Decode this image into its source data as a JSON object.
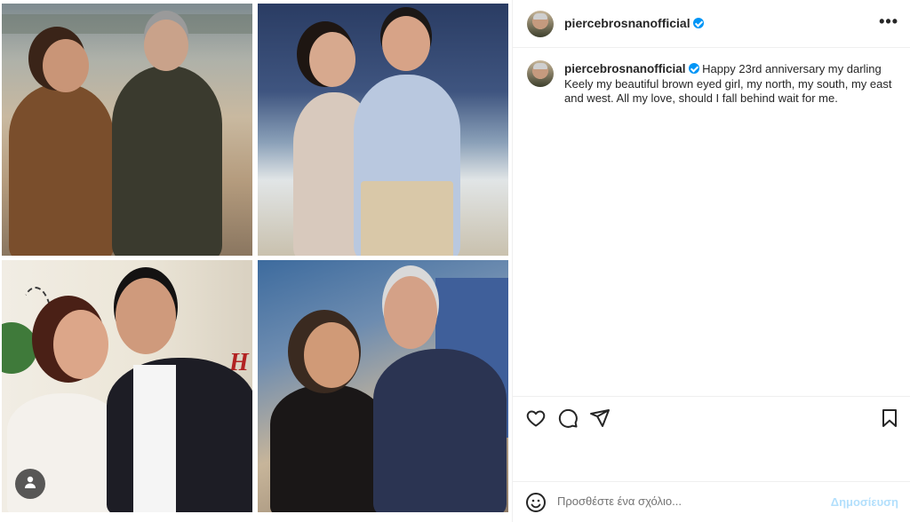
{
  "post": {
    "username": "piercebrosnanofficial",
    "caption_text": "Happy 23rd anniversary my darling Keely my beautiful brown eyed girl, my north, my south, my east and west. All my love, should I fall behind wait for me.",
    "photo3_sign": "H"
  },
  "header": {
    "more_label": "•••"
  },
  "actions": {
    "like_icon": "heart-icon",
    "comment_icon": "comment-icon",
    "share_icon": "paper-plane-icon",
    "save_icon": "bookmark-icon"
  },
  "comment_box": {
    "placeholder": "Προσθέστε ένα σχόλιο...",
    "post_label": "Δημοσίευση"
  },
  "colors": {
    "verified": "#0095f6",
    "post_button_disabled": "#b2dffc",
    "border": "#efefef"
  }
}
